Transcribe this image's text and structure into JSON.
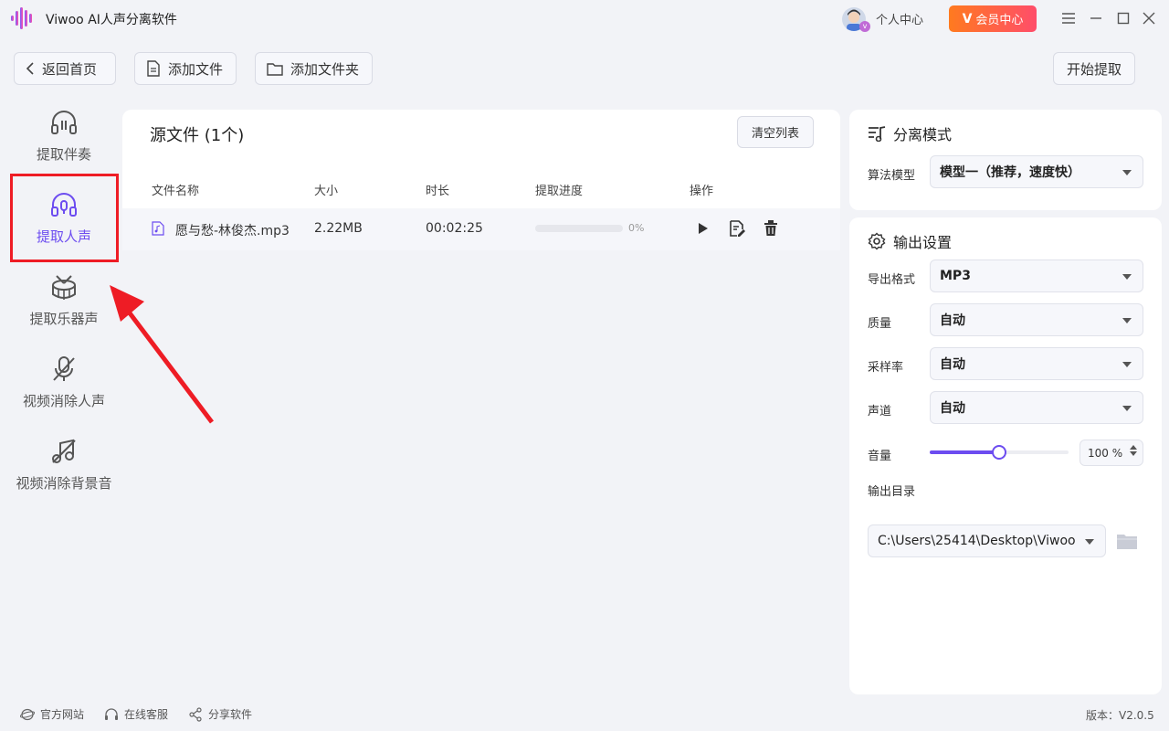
{
  "titlebar": {
    "app_title": "Viwoo AI人声分离软件",
    "user_center": "个人中心",
    "vip_label": "会员中心",
    "vip_mark": "V",
    "avatar_badge": "v"
  },
  "toolbar": {
    "back_label": "返回首页",
    "add_file_label": "添加文件",
    "add_folder_label": "添加文件夹",
    "start_label": "开始提取"
  },
  "sidebar": {
    "items": [
      {
        "label": "提取伴奏",
        "icon": "headphones-icon"
      },
      {
        "label": "提取人声",
        "icon": "headset-mic-icon",
        "active": true
      },
      {
        "label": "提取乐器声",
        "icon": "drum-icon"
      },
      {
        "label": "视频消除人声",
        "icon": "mic-off-icon"
      },
      {
        "label": "视频消除背景音",
        "icon": "music-off-icon"
      }
    ]
  },
  "files": {
    "title": "源文件 (1个)",
    "clear_label": "清空列表",
    "columns": {
      "name": "文件名称",
      "size": "大小",
      "duration": "时长",
      "progress": "提取进度",
      "actions": "操作"
    },
    "rows": [
      {
        "name": "愿与愁-林俊杰.mp3",
        "size": "2.22MB",
        "duration": "00:02:25",
        "progress": 0,
        "progress_text": "0%"
      }
    ]
  },
  "separation": {
    "title": "分离模式",
    "model_label": "算法模型",
    "model_value": "模型一（推荐，速度快）"
  },
  "output": {
    "title": "输出设置",
    "format_label": "导出格式",
    "format_value": "MP3",
    "quality_label": "质量",
    "quality_value": "自动",
    "sample_rate_label": "采样率",
    "sample_rate_value": "自动",
    "channel_label": "声道",
    "channel_value": "自动",
    "volume_label": "音量",
    "volume_value": "100 %",
    "volume_fraction": 0.5,
    "dir_label": "输出目录",
    "dir_value": "C:\\Users\\25414\\Desktop\\Viwoo"
  },
  "footer": {
    "website": "官方网站",
    "support": "在线客服",
    "share": "分享软件",
    "version": "版本：V2.0.5"
  },
  "colors": {
    "accent": "#6c4cf0",
    "highlight": "#ee1c25",
    "vip_start": "#ff7a1f",
    "vip_end": "#ff4d6a"
  }
}
